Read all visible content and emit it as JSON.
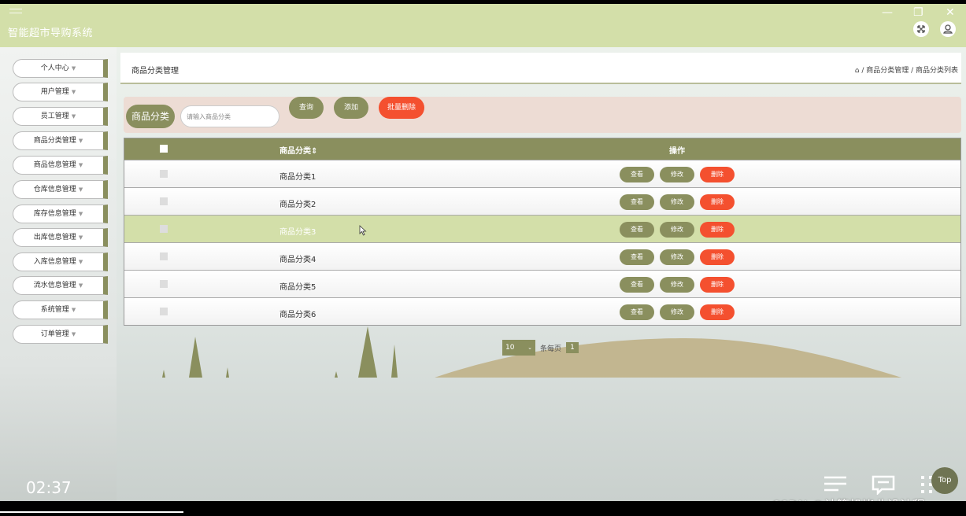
{
  "app": {
    "title": "智能超市导购系统"
  },
  "window_controls": [
    "—",
    "❐",
    "✕"
  ],
  "header_icons": [
    "fullscreen-icon",
    "user-icon"
  ],
  "sidebar": {
    "items": [
      {
        "label": "个人中心"
      },
      {
        "label": "用户管理"
      },
      {
        "label": "员工管理"
      },
      {
        "label": "商品分类管理"
      },
      {
        "label": "商品信息管理"
      },
      {
        "label": "仓库信息管理"
      },
      {
        "label": "库存信息管理"
      },
      {
        "label": "出库信息管理"
      },
      {
        "label": "入库信息管理"
      },
      {
        "label": "流水信息管理"
      },
      {
        "label": "系统管理"
      },
      {
        "label": "订单管理"
      }
    ]
  },
  "page": {
    "title": "商品分类管理",
    "breadcrumb": "/ 商品分类管理 / 商品分类列表"
  },
  "search": {
    "label": "商品分类",
    "placeholder": "请输入商品分类",
    "query_button": "查询",
    "add_button": "添加",
    "batch_delete_button": "批量删除"
  },
  "table": {
    "columns": {
      "name": "商品分类",
      "sort_icon": "sort-icon",
      "sort_symbol": "⇕",
      "ops": "操作"
    },
    "rows": [
      {
        "name": "商品分类1",
        "highlighted": false
      },
      {
        "name": "商品分类2",
        "highlighted": false
      },
      {
        "name": "商品分类3",
        "highlighted": true
      },
      {
        "name": "商品分类4",
        "highlighted": false
      },
      {
        "name": "商品分类5",
        "highlighted": false
      },
      {
        "name": "商品分类6",
        "highlighted": false
      }
    ],
    "actions": {
      "view": "查看",
      "edit": "修改",
      "delete": "删除"
    }
  },
  "pagination": {
    "page_size": "10",
    "per_page_label": "条每页",
    "current_page": "1"
  },
  "video": {
    "time": "02:37",
    "progress": 0.19
  },
  "overlay": {
    "top_button": "Top",
    "watermark": "CSDN @计算机毕业设计程"
  },
  "colors": {
    "header": "#d3dfa9",
    "olive": "#8a8f5e",
    "danger": "#f4502f",
    "search_bg": "#eddcd4"
  }
}
